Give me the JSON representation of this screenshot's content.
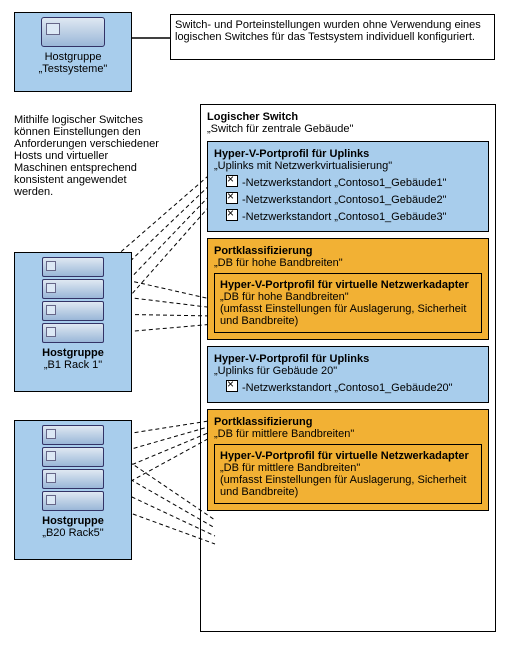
{
  "hostgroup_test": {
    "line1": "Hostgruppe",
    "line2": "„Testsysteme\""
  },
  "note1": "Switch- und Porteinstellungen wurden ohne Verwendung eines logischen Switches für das Testsystem individuell konfiguriert.",
  "desc": "Mithilfe logischer Switches können Einstellungen den Anforderungen verschiedener Hosts und virtueller Maschinen entsprechend konsistent angewendet werden.",
  "logical_switch": {
    "title": "Logischer Switch",
    "subtitle": "„Switch für zentrale Gebäude\"",
    "uplink1": {
      "title": "Hyper-V-Portprofil für Uplinks",
      "subtitle": "„Uplinks mit Netzwerkvirtualisierung\"",
      "sites": [
        "-Netzwerkstandort „Contoso1_Gebäude1\"",
        "-Netzwerkstandort „Contoso1_Gebäude2\"",
        "-Netzwerkstandort „Contoso1_Gebäude3\""
      ]
    },
    "portclass1": {
      "title": "Portklassifizierung",
      "subtitle": "„DB für hohe Bandbreiten\"",
      "inner": {
        "title": "Hyper-V-Portprofil für virtuelle Netzwerkadapter",
        "subtitle": "„DB für hohe Bandbreiten\"",
        "detail": "(umfasst Einstellungen für Auslagerung, Sicherheit und Bandbreite)"
      }
    },
    "uplink2": {
      "title": "Hyper-V-Portprofil für Uplinks",
      "subtitle": "„Uplinks für Gebäude 20\"",
      "sites": [
        "-Netzwerkstandort „Contoso1_Gebäude20\""
      ]
    },
    "portclass2": {
      "title": "Portklassifizierung",
      "subtitle": "„DB für mittlere Bandbreiten\"",
      "inner": {
        "title": "Hyper-V-Portprofil für virtuelle Netzwerkadapter",
        "subtitle": "„DB für mittlere Bandbreiten\"",
        "detail": "(umfasst Einstellungen für Auslagerung, Sicherheit und Bandbreite)"
      }
    }
  },
  "hostgroup1": {
    "line1": "Hostgruppe",
    "line2": "„B1 Rack 1\""
  },
  "hostgroup2": {
    "line1": "Hostgruppe",
    "line2": "„B20 Rack5\""
  }
}
